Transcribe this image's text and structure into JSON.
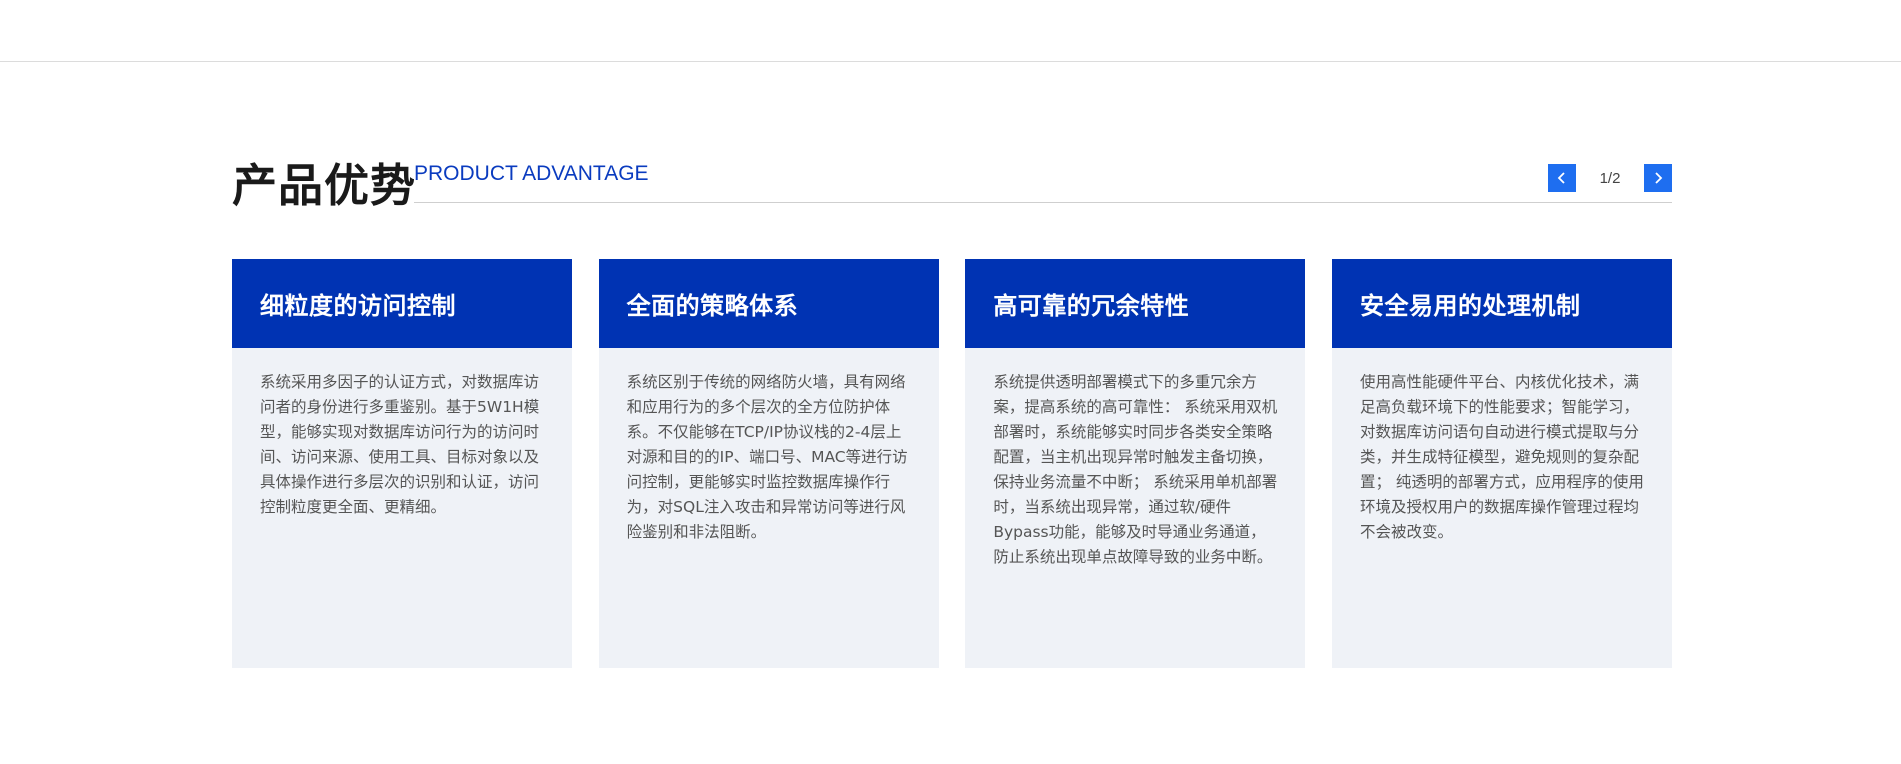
{
  "header": {
    "title_cn": "产品优势",
    "title_en": "PRODUCT ADVANTAGE"
  },
  "pager": {
    "prev_icon": "chevron-left-icon",
    "next_icon": "chevron-right-icon",
    "text": "1/2",
    "accent_color": "#1e6ef0"
  },
  "colors": {
    "card_header": "#0033b3",
    "card_body": "#eff2f7",
    "title_en": "#0a3bbf"
  },
  "cards": [
    {
      "title": "细粒度的访问控制",
      "body": "系统采用多因子的认证方式，对数据库访问者的身份进行多重鉴别。基于5W1H模型，能够实现对数据库访问行为的访问时间、访问来源、使用工具、目标对象以及具体操作进行多层次的识别和认证，访问控制粒度更全面、更精细。"
    },
    {
      "title": "全面的策略体系",
      "body": "系统区别于传统的网络防火墙，具有网络和应用行为的多个层次的全方位防护体系。不仅能够在TCP/IP协议栈的2-4层上对源和目的的IP、端口号、MAC等进行访问控制，更能够实时监控数据库操作行为，对SQL注入攻击和异常访问等进行风险鉴别和非法阻断。"
    },
    {
      "title": "高可靠的冗余特性",
      "body": "系统提供透明部署模式下的多重冗余方案，提高系统的高可靠性： 系统采用双机部署时，系统能够实时同步各类安全策略配置，当主机出现异常时触发主备切换，保持业务流量不中断； 系统采用单机部署时，当系统出现异常，通过软/硬件Bypass功能，能够及时导通业务通道，防止系统出现单点故障导致的业务中断。"
    },
    {
      "title": "安全易用的处理机制",
      "body": "使用高性能硬件平台、内核优化技术，满足高负载环境下的性能要求；智能学习，对数据库访问语句自动进行模式提取与分类，并生成特征模型，避免规则的复杂配置； 纯透明的部署方式，应用程序的使用环境及授权用户的数据库操作管理过程均不会被改变。"
    }
  ]
}
